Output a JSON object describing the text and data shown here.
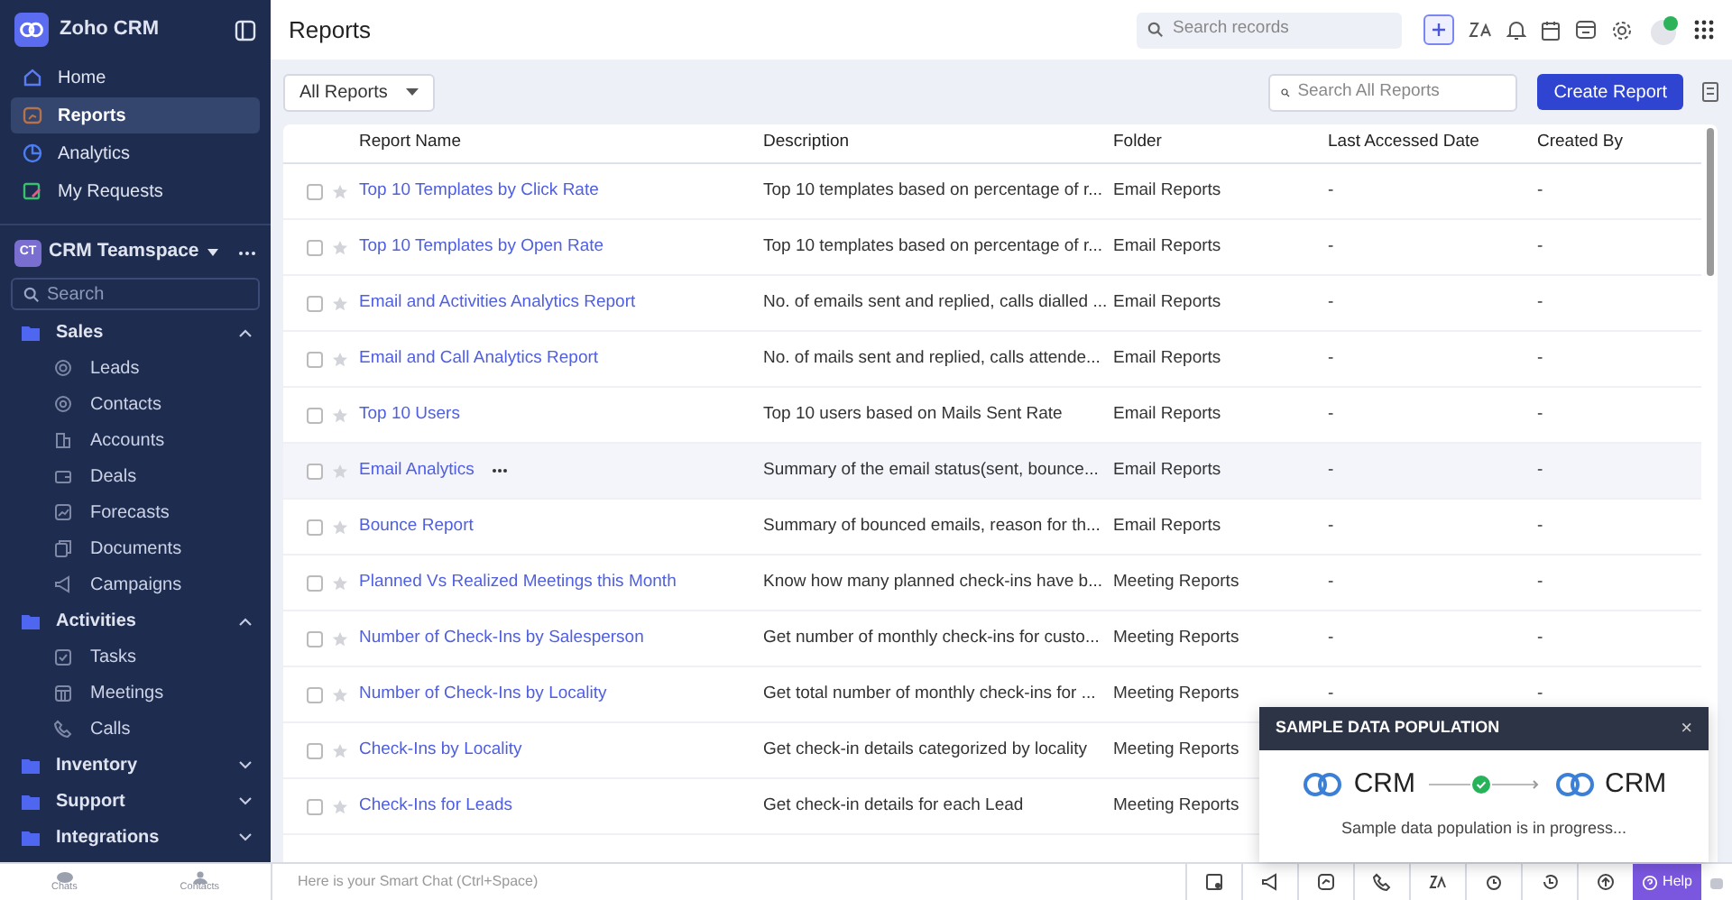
{
  "sidebar": {
    "app_name": "Zoho CRM",
    "nav": [
      {
        "label": "Home",
        "selected": false
      },
      {
        "label": "Reports",
        "selected": true
      },
      {
        "label": "Analytics",
        "selected": false
      },
      {
        "label": "My Requests",
        "selected": false
      }
    ],
    "teamspace": {
      "badge": "CT",
      "name": "CRM Teamspace"
    },
    "search": {
      "placeholder": "Search"
    },
    "groups": [
      {
        "label": "Sales",
        "expanded": true,
        "children": [
          {
            "label": "Leads"
          },
          {
            "label": "Contacts"
          },
          {
            "label": "Accounts"
          },
          {
            "label": "Deals"
          },
          {
            "label": "Forecasts"
          },
          {
            "label": "Documents"
          },
          {
            "label": "Campaigns"
          }
        ]
      },
      {
        "label": "Activities",
        "expanded": true,
        "children": [
          {
            "label": "Tasks"
          },
          {
            "label": "Meetings"
          },
          {
            "label": "Calls"
          }
        ]
      },
      {
        "label": "Inventory",
        "expanded": false
      },
      {
        "label": "Support",
        "expanded": false
      },
      {
        "label": "Integrations",
        "expanded": false
      }
    ],
    "footer": [
      "Chats",
      "Contacts"
    ]
  },
  "header": {
    "title": "Reports",
    "search": {
      "placeholder": "Search records"
    }
  },
  "toolbar": {
    "filter": "All Reports",
    "search": {
      "placeholder": "Search All Reports"
    },
    "create_button": "Create Report"
  },
  "table": {
    "columns": [
      "Report Name",
      "Description",
      "Folder",
      "Last Accessed Date",
      "Created By"
    ],
    "rows": [
      {
        "name": "Top 10 Templates by Click Rate",
        "description": "Top 10 templates based on percentage of r...",
        "folder": "Email Reports",
        "last_accessed": "-",
        "created_by": "-",
        "hovered": false,
        "checked": false
      },
      {
        "name": "Top 10 Templates by Open Rate",
        "description": "Top 10 templates based on percentage of r...",
        "folder": "Email Reports",
        "last_accessed": "-",
        "created_by": "-",
        "hovered": false,
        "checked": false
      },
      {
        "name": "Email and Activities Analytics Report",
        "description": "No. of emails sent and replied, calls dialled ...",
        "folder": "Email Reports",
        "last_accessed": "-",
        "created_by": "-",
        "hovered": false,
        "checked": false
      },
      {
        "name": "Email and Call Analytics Report",
        "description": "No. of mails sent and replied, calls attende...",
        "folder": "Email Reports",
        "last_accessed": "-",
        "created_by": "-",
        "hovered": false,
        "checked": false
      },
      {
        "name": "Top 10 Users",
        "description": "Top 10 users based on Mails Sent Rate",
        "folder": "Email Reports",
        "last_accessed": "-",
        "created_by": "-",
        "hovered": false,
        "checked": false
      },
      {
        "name": "Email Analytics",
        "description": "Summary of the email status(sent, bounce...",
        "folder": "Email Reports",
        "last_accessed": "-",
        "created_by": "-",
        "hovered": true,
        "checked": false
      },
      {
        "name": "Bounce Report",
        "description": "Summary of bounced emails, reason for th...",
        "folder": "Email Reports",
        "last_accessed": "-",
        "created_by": "-",
        "hovered": false,
        "checked": false
      },
      {
        "name": "Planned Vs Realized Meetings this Month",
        "description": "Know how many planned check-ins have b...",
        "folder": "Meeting Reports",
        "last_accessed": "-",
        "created_by": "-",
        "hovered": false,
        "checked": false
      },
      {
        "name": "Number of Check-Ins by Salesperson",
        "description": "Get number of monthly check-ins for custo...",
        "folder": "Meeting Reports",
        "last_accessed": "-",
        "created_by": "-",
        "hovered": false,
        "checked": false
      },
      {
        "name": "Number of Check-Ins by Locality",
        "description": "Get total number of monthly check-ins for ...",
        "folder": "Meeting Reports",
        "last_accessed": "-",
        "created_by": "-",
        "hovered": false,
        "checked": false
      },
      {
        "name": "Check-Ins by Locality",
        "description": "Get check-in details categorized by locality",
        "folder": "Meeting Reports",
        "hovered": false,
        "checked": false
      },
      {
        "name": "Check-Ins for Leads",
        "description": "Get check-in details for each Lead",
        "folder": "Meeting Reports",
        "hovered": false,
        "checked": false
      }
    ]
  },
  "popup": {
    "title": "SAMPLE DATA POPULATION",
    "close": "×",
    "from": "CRM",
    "to": "CRM",
    "message": "Sample data population is in progress..."
  },
  "bottom_bar": {
    "chat_placeholder": "Here is your Smart Chat (Ctrl+Space)",
    "help": "Help"
  }
}
